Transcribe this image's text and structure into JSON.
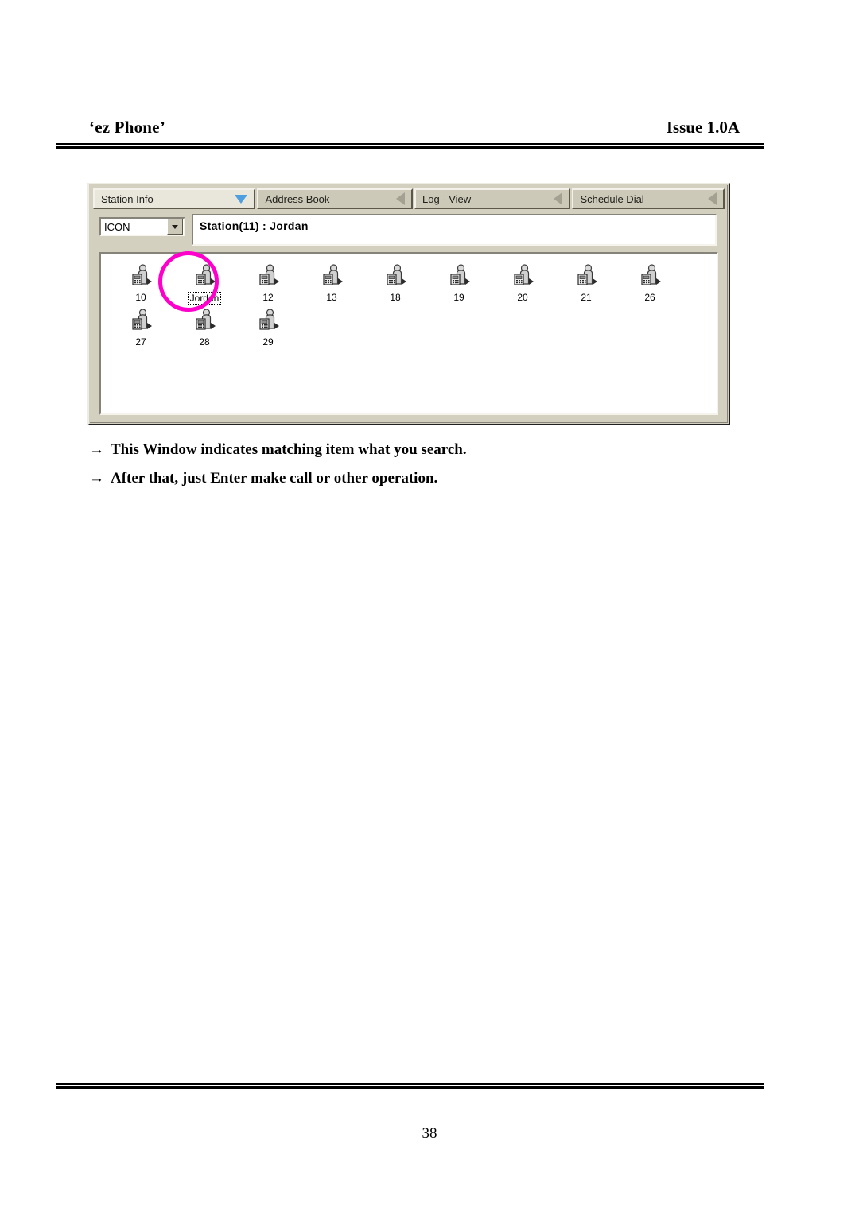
{
  "header": {
    "left_title": "‘ez Phone’",
    "right_title": "Issue 1.0A"
  },
  "window": {
    "tabs": [
      {
        "label": "Station Info",
        "arrow": "chevron-down-icon",
        "active": true
      },
      {
        "label": "Address Book",
        "arrow": "chevron-left-icon",
        "active": false
      },
      {
        "label": "Log - View",
        "arrow": "chevron-left-icon",
        "active": false
      },
      {
        "label": "Schedule Dial",
        "arrow": "chevron-left-icon",
        "active": false
      }
    ],
    "view_mode_combo": {
      "value": "ICON",
      "options": [
        "ICON"
      ]
    },
    "status": "Station(11) :  Jordan",
    "stations": [
      {
        "label": "10",
        "selected": false
      },
      {
        "label": "Jordan",
        "selected": true
      },
      {
        "label": "12",
        "selected": false
      },
      {
        "label": "13",
        "selected": false
      },
      {
        "label": "18",
        "selected": false
      },
      {
        "label": "19",
        "selected": false
      },
      {
        "label": "20",
        "selected": false
      },
      {
        "label": "21",
        "selected": false
      },
      {
        "label": "26",
        "selected": false
      },
      {
        "label": "27",
        "selected": false
      },
      {
        "label": "28",
        "selected": false
      },
      {
        "label": "29",
        "selected": false
      }
    ]
  },
  "annotation": {
    "highlight_color": "#ff00cc",
    "highlight_target": "Jordan"
  },
  "notes": [
    {
      "arrow": "→",
      "text": "This Window indicates matching item what you search."
    },
    {
      "arrow": "→",
      "text": "After that, just Enter make call or other operation."
    }
  ],
  "footer": {
    "page_number": "38"
  }
}
